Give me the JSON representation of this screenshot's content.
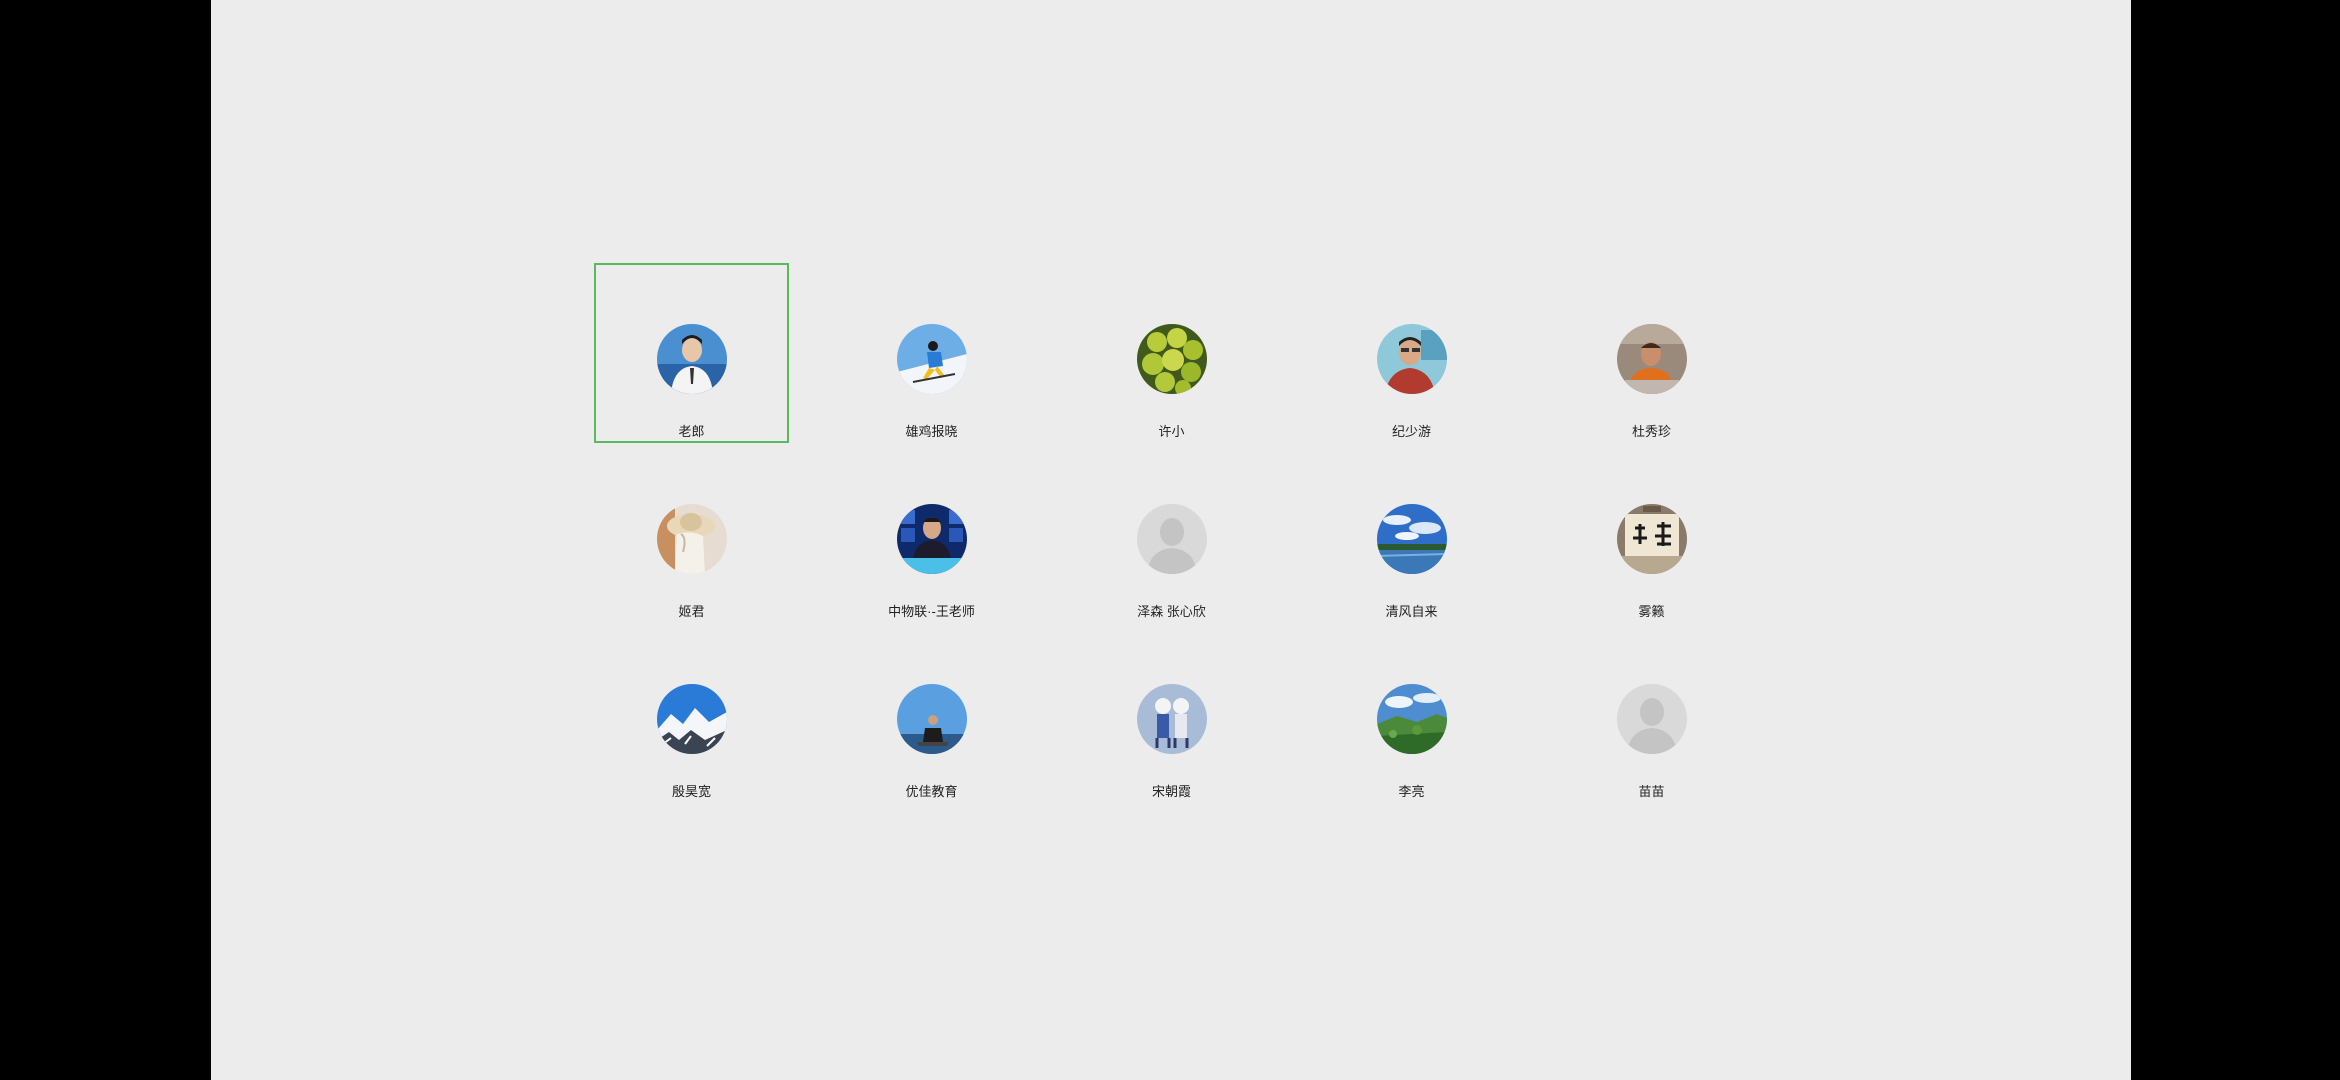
{
  "colors": {
    "background": "#ececec",
    "selection_border": "#5cb85c"
  },
  "contacts": [
    {
      "name": "老郎",
      "avatar": "man-portrait-blue",
      "selected": true
    },
    {
      "name": "雄鸡报晓",
      "avatar": "skier-snow"
    },
    {
      "name": "许小",
      "avatar": "green-grapes"
    },
    {
      "name": "纪少游",
      "avatar": "man-red-shirt"
    },
    {
      "name": "杜秀珍",
      "avatar": "person-orange-robe"
    },
    {
      "name": "姬君",
      "avatar": "woman-sunhat"
    },
    {
      "name": "中物联·-王老师",
      "avatar": "man-tv-studio"
    },
    {
      "name": "泽森 张心欣",
      "avatar": "default-user-silhouette"
    },
    {
      "name": "清风自来",
      "avatar": "blue-sky-lake"
    },
    {
      "name": "雾籁",
      "avatar": "calligraphy-scroll"
    },
    {
      "name": "殷昊宽",
      "avatar": "snow-mountains"
    },
    {
      "name": "优佳教育",
      "avatar": "man-sitting-sky"
    },
    {
      "name": "宋朝霞",
      "avatar": "couple-cartoon"
    },
    {
      "name": "李亮",
      "avatar": "green-hills-sky"
    },
    {
      "name": "苗苗",
      "avatar": "default-user-silhouette"
    }
  ]
}
